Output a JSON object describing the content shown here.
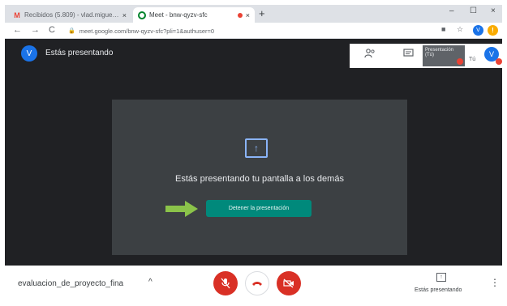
{
  "browser": {
    "tabs": [
      {
        "title": "Recibidos (5.809) - vlad.miguel@...",
        "icon": "gmail-icon",
        "close": "×"
      },
      {
        "title": "Meet - bnw-qyzv-sfc",
        "icon": "meet-icon",
        "close": "×"
      }
    ],
    "new_tab": "+",
    "window_controls": {
      "minimize": "–",
      "maximize": "☐",
      "close": "×"
    },
    "nav": {
      "back": "←",
      "forward": "→",
      "reload": "C"
    },
    "url": "meet.google.com/bnw-qyzv-sfc?pli=1&authuser=0",
    "profile_initial": "V",
    "warning_icon": "!"
  },
  "meet": {
    "presenter_initial": "V",
    "presenting_label": "Estás presentando",
    "thumbnail_label": "Presentación (Tú)",
    "self_label": "Tú",
    "self_initial": "V",
    "share_message": "Estás presentando tu pantalla a los demás",
    "stop_button": "Detener la presentación",
    "share_arrow_glyph": "↑",
    "meeting_name": "evaluacion_de_proyecto_fina",
    "caret": "^",
    "present_label": "Estás presentando",
    "more": "⋮"
  },
  "colors": {
    "meet_bg": "#202124",
    "card_bg": "#3c4043",
    "accent_teal": "#00897b",
    "danger_red": "#d93025",
    "arrow_green": "#8bc34a",
    "avatar_blue": "#1a73e8"
  }
}
